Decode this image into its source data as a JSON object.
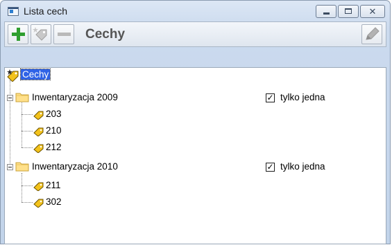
{
  "window": {
    "title": "Lista cech"
  },
  "title_buttons": {
    "close_glyph": "✕"
  },
  "toolbar": {
    "title": "Cechy"
  },
  "tree": {
    "root": "Cechy",
    "groups": [
      {
        "label": "Inwentaryzacja 2009",
        "checkbox_label": "tylko jedna",
        "checked": true,
        "items": [
          "203",
          "210",
          "212"
        ]
      },
      {
        "label": "Inwentaryzacja 2010",
        "checkbox_label": "tylko jedna",
        "checked": true,
        "items": [
          "211",
          "302"
        ]
      }
    ]
  },
  "colors": {
    "selection": "#2f63e6",
    "tag_yellow": "#f3c21b",
    "add_green": "#2f9e2f"
  },
  "icons": {
    "app": "window-icon",
    "add": "plus-icon",
    "tag_disabled": "tag-star-icon",
    "remove": "minus-icon",
    "edit": "pencil-icon",
    "folder": "folder-icon",
    "item": "tag-icon"
  }
}
